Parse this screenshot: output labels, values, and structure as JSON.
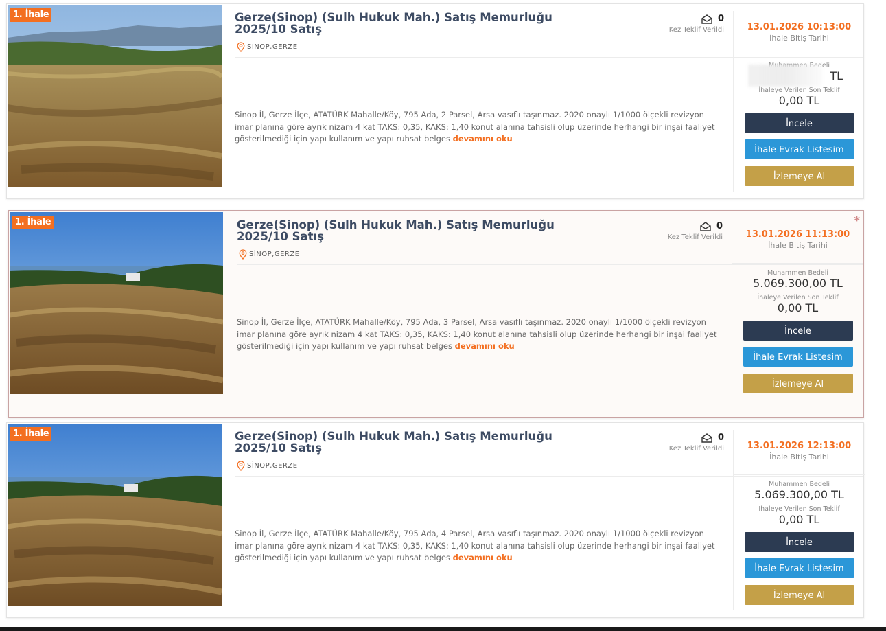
{
  "listings": [
    {
      "badge": "1. İhale",
      "title": "Gerze(Sinop) (Sulh Hukuk Mah.) Satış Memurluğu 2025/10 Satış",
      "location": "SİNOP,GERZE",
      "bid_count": "0",
      "bid_count_label": "Kez Teklif Verildi",
      "end_date": "13.01.2026 10:13:00",
      "end_date_label": "İhale Bitiş Tarihi",
      "estimate_label": "Muhammen Bedeli",
      "estimate_value": "TL",
      "last_bid_label": "İhaleye Verilen Son Teklif",
      "last_bid_value": "0,00 TL",
      "description": "Sinop İl, Gerze İlçe, ATATÜRK Mahalle/Köy, 795 Ada, 2 Parsel, Arsa vasıflı taşınmaz. 2020 onaylı 1/1000 ölçekli revizyon imar planına göre ayrık nizam 4 kat TAKS: 0,35, KAKS: 1,40 konut alanına tahsisli olup üzerinde herhangi bir inşai faaliyet gösterilmediği için yapı kullanım ve yapı ruhsat belges",
      "more_link": "devamını oku",
      "btn_inspect": "İncele",
      "btn_docs": "İhale Evrak Listesim",
      "btn_watch": "İzlemeye Al"
    },
    {
      "badge": "1. İhale",
      "title": "Gerze(Sinop) (Sulh Hukuk Mah.) Satış Memurluğu 2025/10 Satış",
      "location": "SİNOP,GERZE",
      "bid_count": "0",
      "bid_count_label": "Kez Teklif Verildi",
      "end_date": "13.01.2026 11:13:00",
      "end_date_label": "İhale Bitiş Tarihi",
      "estimate_label": "Muhammen Bedeli",
      "estimate_value": "5.069.300,00 TL",
      "last_bid_label": "İhaleye Verilen Son Teklif",
      "last_bid_value": "0,00 TL",
      "description": "Sinop İl, Gerze İlçe, ATATÜRK Mahalle/Köy, 795 Ada, 3 Parsel, Arsa vasıflı taşınmaz. 2020 onaylı 1/1000 ölçekli revizyon imar planına göre ayrık nizam 4 kat TAKS: 0,35, KAKS: 1,40 konut alanına tahsisli olup üzerinde herhangi bir inşai faaliyet gösterilmediği için yapı kullanım ve yapı ruhsat belges",
      "more_link": "devamını oku",
      "btn_inspect": "İncele",
      "btn_docs": "İhale Evrak Listesim",
      "btn_watch": "İzlemeye Al",
      "star": "*"
    },
    {
      "badge": "1. İhale",
      "title": "Gerze(Sinop) (Sulh Hukuk Mah.) Satış Memurluğu 2025/10 Satış",
      "location": "SİNOP,GERZE",
      "bid_count": "0",
      "bid_count_label": "Kez Teklif Verildi",
      "end_date": "13.01.2026 12:13:00",
      "end_date_label": "İhale Bitiş Tarihi",
      "estimate_label": "Muhammen Bedeli",
      "estimate_value": "5.069.300,00 TL",
      "last_bid_label": "İhaleye Verilen Son Teklif",
      "last_bid_value": "0,00 TL",
      "description": "Sinop İl, Gerze İlçe, ATATÜRK Mahalle/Köy, 795 Ada, 4 Parsel, Arsa vasıflı taşınmaz. 2020 onaylı 1/1000 ölçekli revizyon imar planına göre ayrık nizam 4 kat TAKS: 0,35, KAKS: 1,40 konut alanına tahsisli olup üzerinde herhangi bir inşai faaliyet gösterilmediği için yapı kullanım ve yapı ruhsat belges",
      "more_link": "devamını oku",
      "btn_inspect": "İncele",
      "btn_docs": "İhale Evrak Listesim",
      "btn_watch": "İzlemeye Al"
    }
  ],
  "colors": {
    "accent_orange": "#f36f21",
    "btn_dark": "#2c3b52",
    "btn_blue": "#2b97d8",
    "btn_gold": "#c4a048",
    "title": "#3d4b63"
  },
  "icons": [
    "pin-icon",
    "envelope-icon",
    "star-icon"
  ]
}
